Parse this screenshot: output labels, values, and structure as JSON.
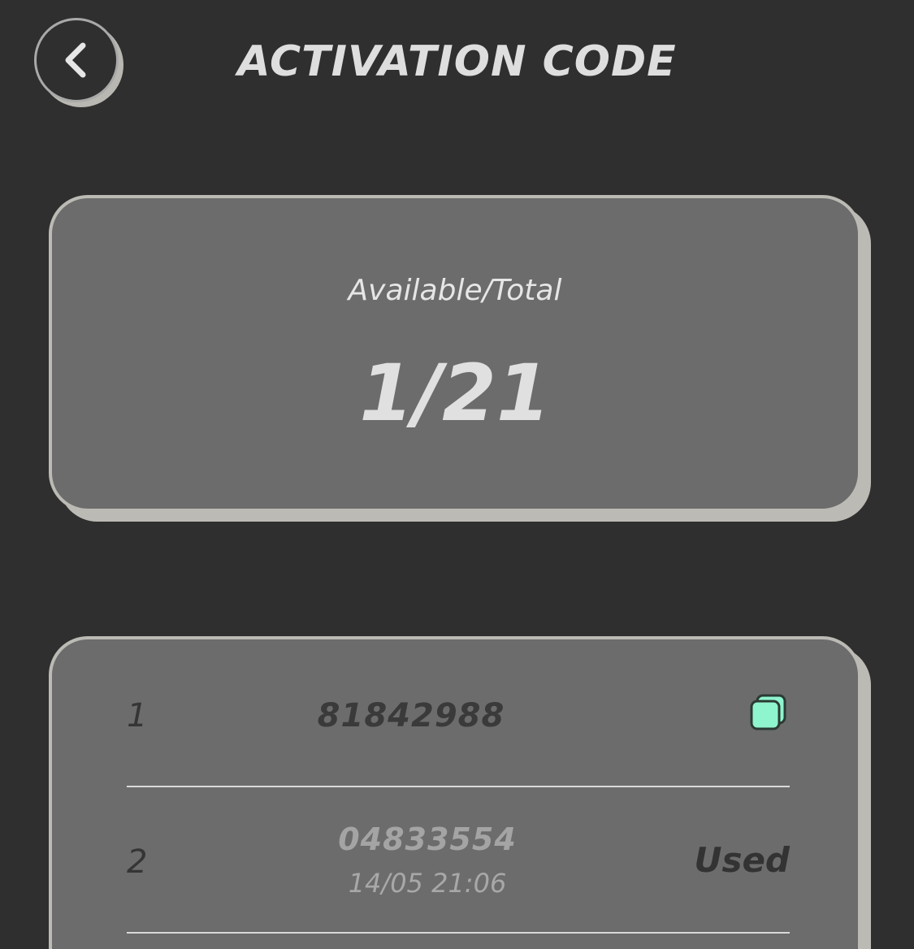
{
  "header": {
    "title": "ACTIVATION CODE",
    "back_icon": "chevron-left-icon"
  },
  "summary": {
    "label": "Available/Total",
    "value": "1/21",
    "available": 1,
    "total": 21
  },
  "codes": [
    {
      "index": "1",
      "code": "81842988",
      "status": "available",
      "action_icon": "copy-icon"
    },
    {
      "index": "2",
      "code": "04833554",
      "date": "14/05 21:06",
      "status_label": "Used"
    }
  ],
  "colors": {
    "background": "#2f2f2f",
    "card": "#6c6c6c",
    "card_border": "#bcbab4",
    "copy_icon": "#8ff5cf"
  }
}
